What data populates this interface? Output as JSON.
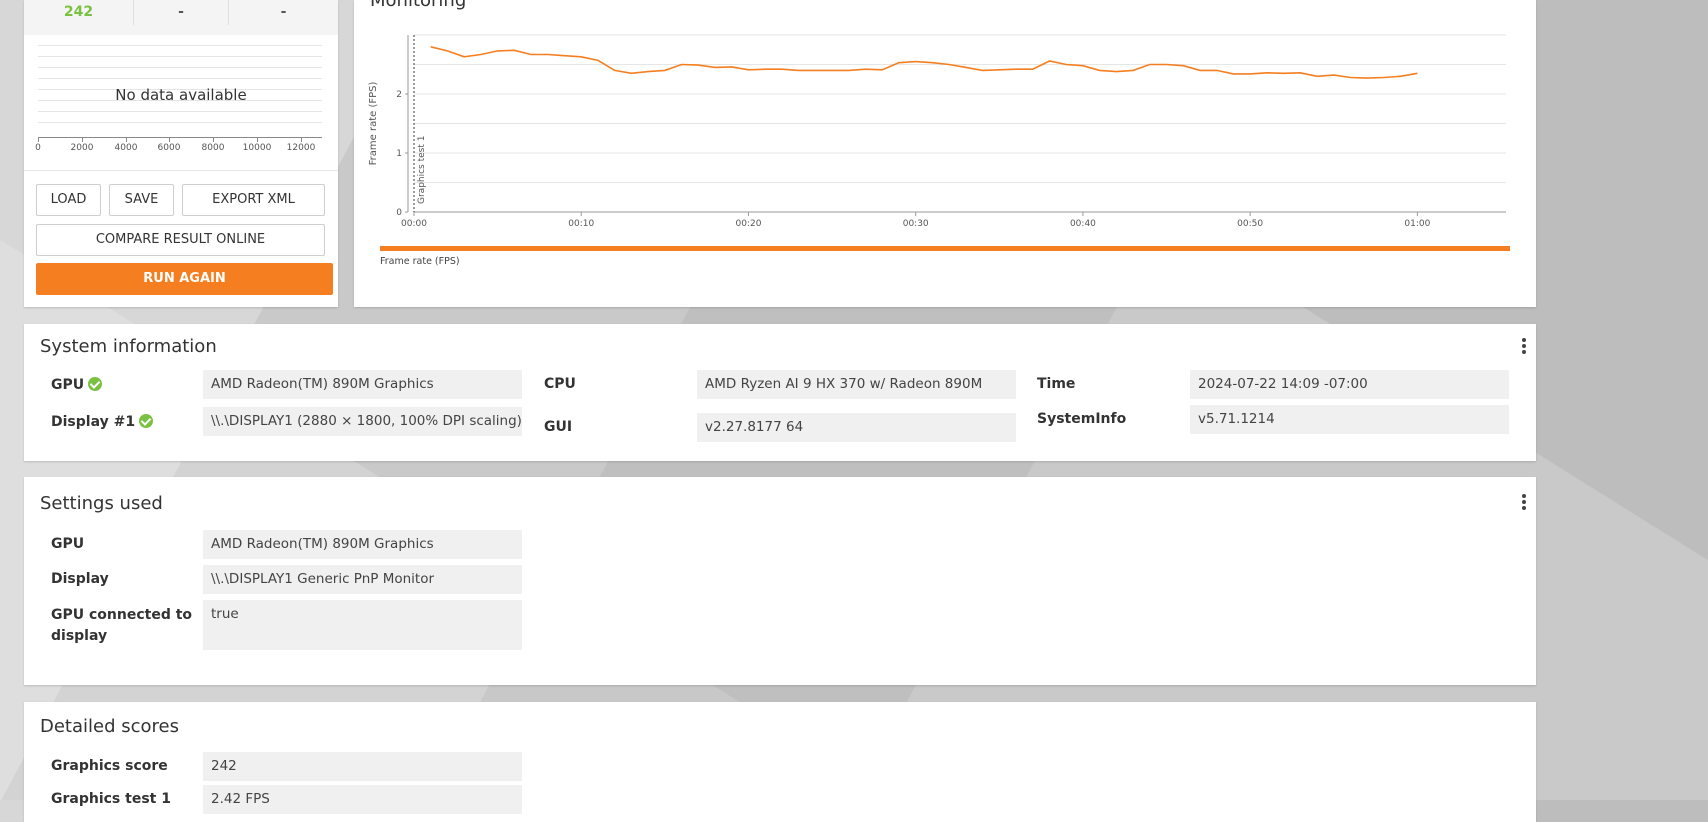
{
  "summary": {
    "scores": [
      "242",
      "-",
      "-"
    ],
    "histogram": {
      "no_data": "No data available",
      "ticks": [
        "0",
        "2000",
        "4000",
        "6000",
        "8000",
        "10000",
        "12000"
      ]
    },
    "buttons": {
      "load": "LOAD",
      "save": "SAVE",
      "export": "EXPORT XML",
      "compare": "COMPARE RESULT ONLINE",
      "run": "RUN AGAIN"
    }
  },
  "monitoring": {
    "title": "Monitoring",
    "legend": "Frame rate (FPS)"
  },
  "chart_data": {
    "type": "line",
    "ylabel": "Frame rate (FPS)",
    "xlabel": "",
    "ylim": [
      0,
      3
    ],
    "yticks": [
      "0",
      "1",
      "2"
    ],
    "xticks": [
      "00:00",
      "00:10",
      "00:20",
      "00:30",
      "00:40",
      "00:50",
      "01:00"
    ],
    "xlim_seconds": [
      0,
      65
    ],
    "marker": {
      "x": 0,
      "label": "Graphics test 1"
    },
    "series": [
      {
        "name": "Frame rate (FPS)",
        "color": "#f57f20",
        "x": [
          1,
          2,
          3,
          4,
          5,
          6,
          7,
          8,
          9,
          10,
          11,
          12,
          13,
          14,
          15,
          16,
          17,
          18,
          19,
          20,
          21,
          22,
          23,
          24,
          25,
          26,
          27,
          28,
          29,
          30,
          31,
          32,
          33,
          34,
          35,
          36,
          37,
          38,
          39,
          40,
          41,
          42,
          43,
          44,
          45,
          46,
          47,
          48,
          49,
          50,
          51,
          52,
          53,
          54,
          55,
          56,
          57,
          58,
          59,
          60
        ],
        "values": [
          2.8,
          2.73,
          2.63,
          2.67,
          2.73,
          2.74,
          2.67,
          2.67,
          2.65,
          2.63,
          2.57,
          2.4,
          2.35,
          2.38,
          2.4,
          2.5,
          2.49,
          2.45,
          2.46,
          2.41,
          2.42,
          2.42,
          2.4,
          2.4,
          2.4,
          2.4,
          2.42,
          2.41,
          2.53,
          2.55,
          2.53,
          2.5,
          2.45,
          2.4,
          2.41,
          2.42,
          2.42,
          2.56,
          2.5,
          2.48,
          2.4,
          2.38,
          2.4,
          2.5,
          2.5,
          2.48,
          2.4,
          2.4,
          2.34,
          2.34,
          2.36,
          2.35,
          2.36,
          2.3,
          2.32,
          2.28,
          2.27,
          2.28,
          2.3,
          2.35
        ]
      }
    ]
  },
  "system_info": {
    "title": "System information",
    "gpu_label": "GPU",
    "gpu_value": "AMD Radeon(TM) 890M Graphics",
    "display_label": "Display #1",
    "display_value": "\\\\.\\DISPLAY1 (2880 × 1800, 100% DPI scaling)",
    "cpu_label": "CPU",
    "cpu_value": "AMD Ryzen AI 9 HX 370 w/ Radeon 890M",
    "gui_label": "GUI",
    "gui_value": "v2.27.8177 64",
    "time_label": "Time",
    "time_value": "2024-07-22 14:09 -07:00",
    "sysinfo_label": "SystemInfo",
    "sysinfo_value": "v5.71.1214"
  },
  "settings": {
    "title": "Settings used",
    "gpu_label": "GPU",
    "gpu_value": "AMD Radeon(TM) 890M Graphics",
    "display_label": "Display",
    "display_value": "\\\\.\\DISPLAY1 Generic PnP Monitor",
    "connected_label_1": "GPU connected to",
    "connected_label_2": "display",
    "connected_value": "true"
  },
  "detailed": {
    "title": "Detailed scores",
    "graphics_score_label": "Graphics score",
    "graphics_score_value": "242",
    "test1_label": "Graphics test 1",
    "test1_value": "2.42 FPS"
  }
}
